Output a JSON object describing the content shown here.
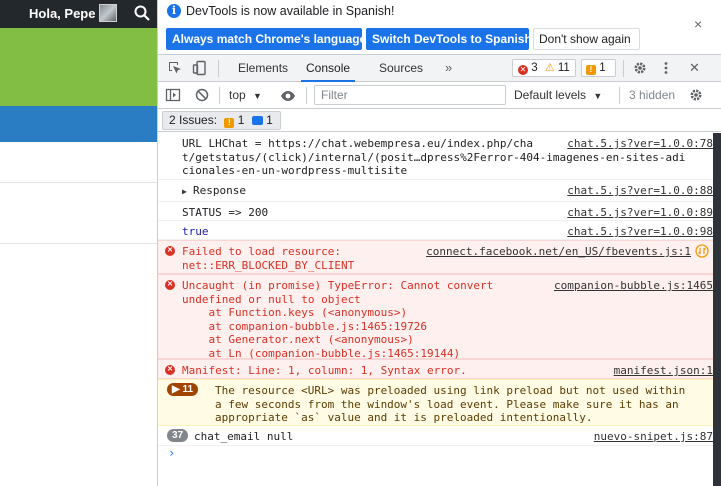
{
  "site": {
    "greeting": "Hola, Pepe"
  },
  "infobar": {
    "message": "DevTools is now available in Spanish!",
    "btn_match": "Always match Chrome's language",
    "btn_switch": "Switch DevTools to Spanish",
    "btn_dismiss": "Don't show again",
    "close": "×"
  },
  "toolbar": {
    "tabs": [
      "Elements",
      "Console",
      "Sources"
    ],
    "more": "»",
    "error_count": "3",
    "warning_count": "11",
    "issues_count": "1",
    "close": "✕"
  },
  "console_toolbar": {
    "context": "top",
    "filter_placeholder": "Filter",
    "levels": "Default levels",
    "hidden": "3 hidden"
  },
  "issues_bar": {
    "label": "2 Issues:",
    "warn_count": "1",
    "info_count": "1"
  },
  "messages": [
    {
      "text": "URL LHChat = https://chat.webempresa.eu/index.php/cha\nt/getstatus/(click)/internal/(posit…dpress%2Ferror-404-imagenes-en-sites-adi\ncionales-en-un-wordpress-multisite",
      "source": "chat.5.js?ver=1.0.0:78"
    },
    {
      "text": "Response",
      "source": "chat.5.js?ver=1.0.0:88"
    },
    {
      "text": "STATUS => 200",
      "source": "chat.5.js?ver=1.0.0:89"
    },
    {
      "text": "true",
      "source": "chat.5.js?ver=1.0.0:98"
    },
    {
      "text": "Failed to load resource:\nnet::ERR_BLOCKED_BY_CLIENT",
      "source": "connect.facebook.net/en_US/fbevents.js:1"
    },
    {
      "text": "Uncaught (in promise) TypeError: Cannot convert\nundefined or null to object\n    at Function.keys (<anonymous>)\n    at companion-bubble.js:1465:19726\n    at Generator.next (<anonymous>)\n    at Ln (companion-bubble.js:1465:19144)",
      "source": "companion-bubble.js:1465"
    },
    {
      "text": "Manifest: Line: 1, column: 1, Syntax error.",
      "source": "manifest.json:1"
    },
    {
      "text": "The resource <URL> was preloaded using link preload but not used within\na few seconds from the window's load event. Please make sure it has an\nappropriate `as` value and it is preloaded intentionally.",
      "repeat": "11"
    },
    {
      "text": "chat_email null",
      "source": "nuevo-snipet.js:87",
      "repeat": "37"
    }
  ],
  "prompt": "›",
  "colors": {
    "accent": "#1a73e8",
    "error": "#d93025",
    "warning_badge": "#a14400",
    "site_green": "#82bd44",
    "site_blue": "#2a7cc3"
  }
}
